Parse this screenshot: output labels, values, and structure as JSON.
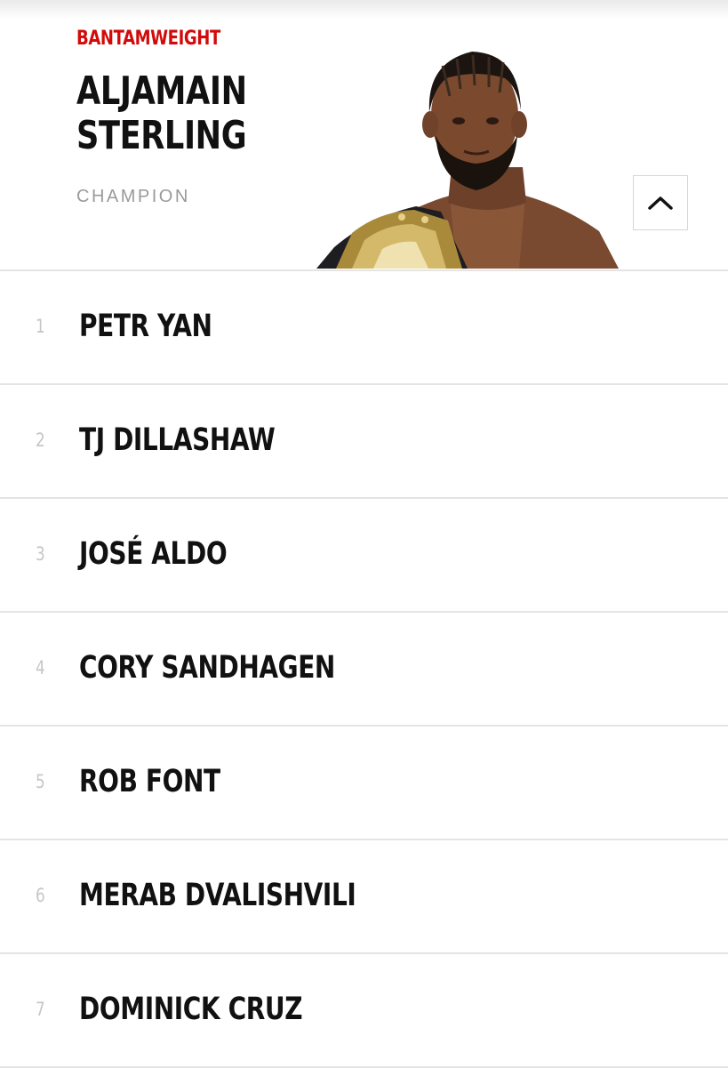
{
  "champion": {
    "division": "BANTAMWEIGHT",
    "name_line1": "ALJAMAIN",
    "name_line2": "STERLING",
    "status": "CHAMPION",
    "photo_alt": "Aljamain Sterling"
  },
  "collapse_icon": "chevron-up-icon",
  "rankings": [
    {
      "rank": "1",
      "name": "PETR YAN"
    },
    {
      "rank": "2",
      "name": "TJ DILLASHAW"
    },
    {
      "rank": "3",
      "name": "JOSÉ ALDO"
    },
    {
      "rank": "4",
      "name": "CORY SANDHAGEN"
    },
    {
      "rank": "5",
      "name": "ROB FONT"
    },
    {
      "rank": "6",
      "name": "MERAB DVALISHVILI"
    },
    {
      "rank": "7",
      "name": "DOMINICK CRUZ"
    }
  ],
  "colors": {
    "accent": "#d20a0a",
    "text": "#111111",
    "muted": "#9a9a9a",
    "rank_number": "#c6c6c6",
    "divider": "#e4e4e4"
  }
}
